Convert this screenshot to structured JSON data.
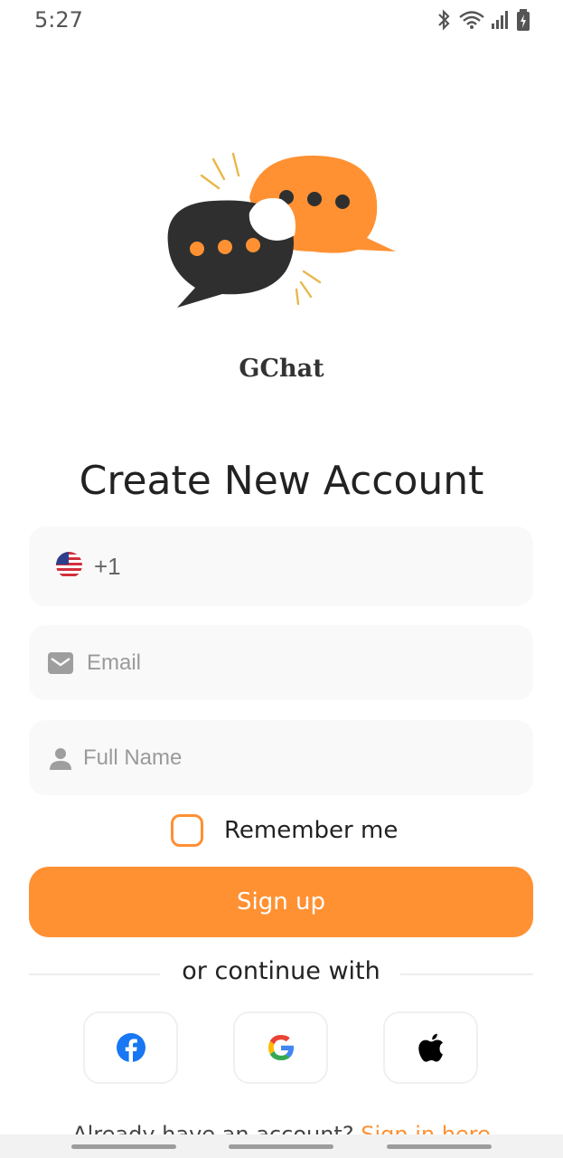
{
  "status_bar": {
    "time": "5:27",
    "icons": [
      "bluetooth-icon",
      "wifi-icon",
      "signal-icon",
      "battery-charging-icon"
    ]
  },
  "app": {
    "name": "GChat",
    "logo": "chat-bubbles-logo",
    "colors": {
      "accent": "#ff9133",
      "dark": "#2f2f2f"
    }
  },
  "form": {
    "title": "Create New Account",
    "phone": {
      "country_flag": "us-flag-icon",
      "country_code": "+1",
      "value": ""
    },
    "email": {
      "placeholder": "Email",
      "icon": "mail-icon"
    },
    "full_name": {
      "placeholder": "Full Name",
      "icon": "person-icon"
    },
    "remember_me": {
      "label": "Remember me",
      "checked": false
    },
    "submit_label": "Sign up"
  },
  "social": {
    "divider_text": "or continue with",
    "providers": [
      "facebook-icon",
      "google-icon",
      "apple-icon"
    ]
  },
  "footer": {
    "prompt": "Already have an account?",
    "link": "Sign in here"
  }
}
